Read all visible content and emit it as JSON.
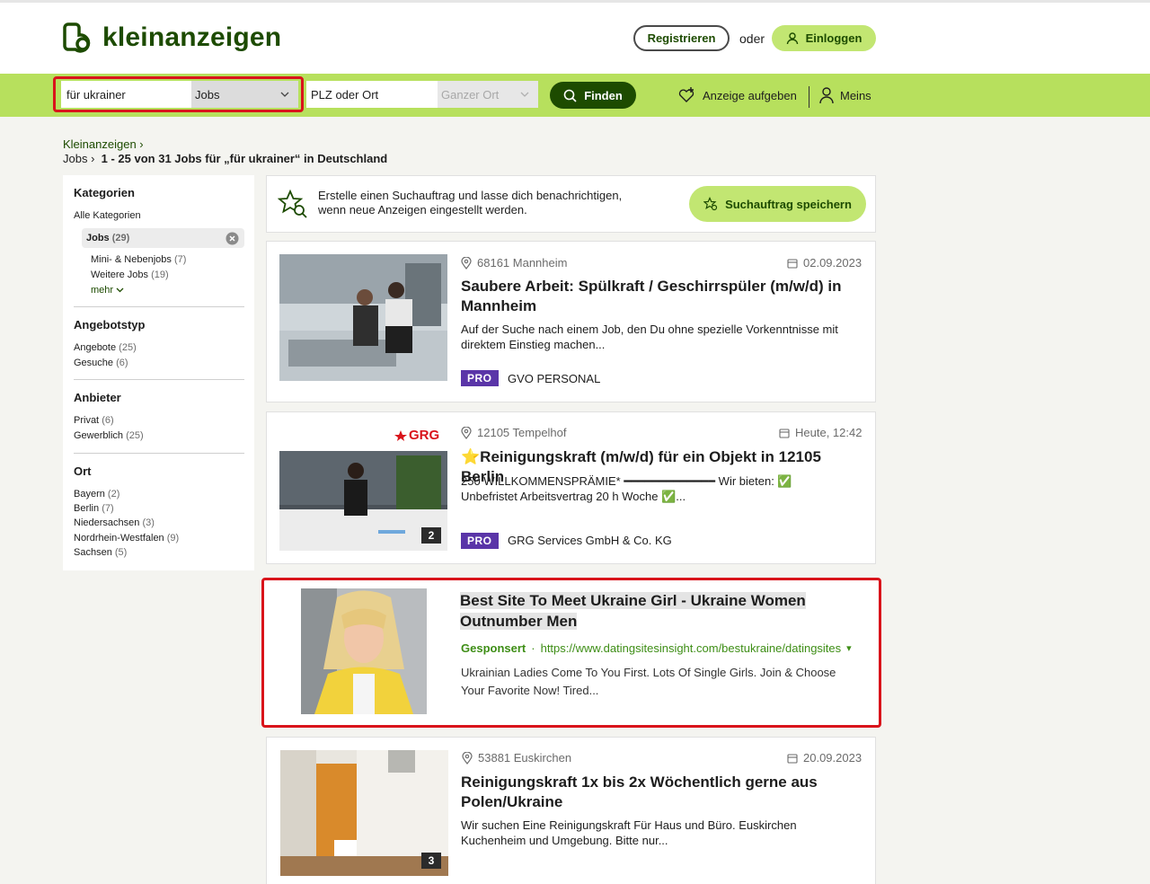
{
  "header": {
    "brand": "kleinanzeigen",
    "register_label": "Registrieren",
    "or_label": "oder",
    "login_label": "Einloggen"
  },
  "search": {
    "query": "für ukrainer",
    "category": "Jobs",
    "location_placeholder": "PLZ oder Ort",
    "radius": "Ganzer Ort",
    "find_label": "Finden",
    "post_ad_label": "Anzeige aufgeben",
    "account_label": "Meins"
  },
  "breadcrumb": {
    "home": "Kleinanzeigen",
    "section": "Jobs",
    "results": "1 - 25 von 31 Jobs für „für ukrainer“ in Deutschland"
  },
  "sidebar": {
    "categories_heading": "Kategorien",
    "all_categories": "Alle Kategorien",
    "active_category": {
      "label": "Jobs",
      "count": "(29)"
    },
    "subcategories": [
      {
        "label": "Mini- & Nebenjobs",
        "count": "(7)"
      },
      {
        "label": "Weitere Jobs",
        "count": "(19)"
      }
    ],
    "more_label": "mehr",
    "offer_type_heading": "Angebotstyp",
    "offer_types": [
      {
        "label": "Angebote",
        "count": "(25)"
      },
      {
        "label": "Gesuche",
        "count": "(6)"
      }
    ],
    "provider_heading": "Anbieter",
    "providers": [
      {
        "label": "Privat",
        "count": "(6)"
      },
      {
        "label": "Gewerblich",
        "count": "(25)"
      }
    ],
    "location_heading": "Ort",
    "locations": [
      {
        "label": "Bayern",
        "count": "(2)"
      },
      {
        "label": "Berlin",
        "count": "(7)"
      },
      {
        "label": "Niedersachsen",
        "count": "(3)"
      },
      {
        "label": "Nordrhein-Westfalen",
        "count": "(9)"
      },
      {
        "label": "Sachsen",
        "count": "(5)"
      }
    ]
  },
  "save_search": {
    "text_line1": "Erstelle einen Suchauftrag und lasse dich benachrichtigen,",
    "text_line2": "wenn neue Anzeigen eingestellt werden.",
    "button_label": "Suchauftrag speichern"
  },
  "listings": [
    {
      "location": "68161 Mannheim",
      "date": "02.09.2023",
      "title_line1": "Saubere Arbeit: Spülkraft / Geschirrspüler (m/w/d) in",
      "title_line2": "Mannheim",
      "desc_line1": "Auf der Suche nach einem Job, den Du ohne spezielle Vorkenntnisse mit",
      "desc_line2": "direktem Einstieg machen...",
      "pro_label": "PRO",
      "seller": "GVO PERSONAL"
    },
    {
      "location": "12105 Tempelhof",
      "date": "Heute, 12:42",
      "title_line1": "⭐Reinigungskraft (m/w/d) für ein Objekt in 12105 Berlin",
      "desc_line1": "250 WILLKOMMENSPRÄMIE* ━━━━━━━━━━━━━ Wir bieten: ✅",
      "desc_line2": "Unbefristet Arbeitsvertrag 20 h Woche ✅...",
      "image_count": "2",
      "logo_text": "GRG",
      "pro_label": "PRO",
      "seller": "GRG Services GmbH & Co. KG"
    },
    {
      "location": "53881 Euskirchen",
      "date": "20.09.2023",
      "title_line1": "Reinigungskraft 1x bis 2x Wöchentlich gerne aus",
      "title_line2": "Polen/Ukraine",
      "desc_line1": "Wir suchen Eine Reinigungskraft Für Haus und Büro. Euskirchen",
      "desc_line2": "Kuchenheim und Umgebung. Bitte nur...",
      "image_count": "3"
    }
  ],
  "sponsored": {
    "title_line1": "Best Site To Meet Ukraine Girl - Ukraine Women",
    "title_line2": "Outnumber Men",
    "sponsored_label": "Gesponsert",
    "dot": "·",
    "url": "https://www.datingsitesinsight.com/bestukraine/datingsites",
    "url_arrow": "▾",
    "desc_line1": "Ukrainian Ladies Come To You First. Lots Of Single Girls. Join & Choose",
    "desc_line2": "Your Favorite Now! Tired..."
  },
  "colors": {
    "brand_dark": "#1d4b00",
    "brand_light": "#b7e05d",
    "button_light": "#c2e672",
    "highlight_red": "#d9141b",
    "pro_purple": "#5a35a8"
  },
  "icons": [
    "logo-icon",
    "user-icon",
    "search-icon",
    "chevron-down-icon",
    "add-heart-icon",
    "star-search-icon",
    "clear-icon",
    "location-pin-icon",
    "calendar-icon"
  ]
}
